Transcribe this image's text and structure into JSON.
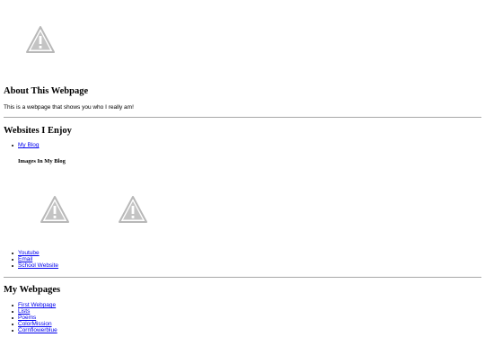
{
  "about": {
    "heading": "About This Webpage",
    "text": "This is a webpage that shows you who I really am!"
  },
  "websites": {
    "heading": "Websites I Enjoy",
    "first_link": "My Blog",
    "blog_images_heading": "Images In My Blog",
    "more_links": [
      "Youtube",
      "Email",
      "School Website"
    ]
  },
  "webpages": {
    "heading": "My Webpages",
    "links": [
      "First Webpage",
      "Lists",
      "Poems",
      "ColorMission",
      "Cornflowerblue"
    ]
  },
  "icons": {
    "broken_image": "broken-image-warning-icon"
  },
  "colors": {
    "link": "#0000ee",
    "rule": "#a8a8a8",
    "placeholder": "#b8b8b8"
  }
}
